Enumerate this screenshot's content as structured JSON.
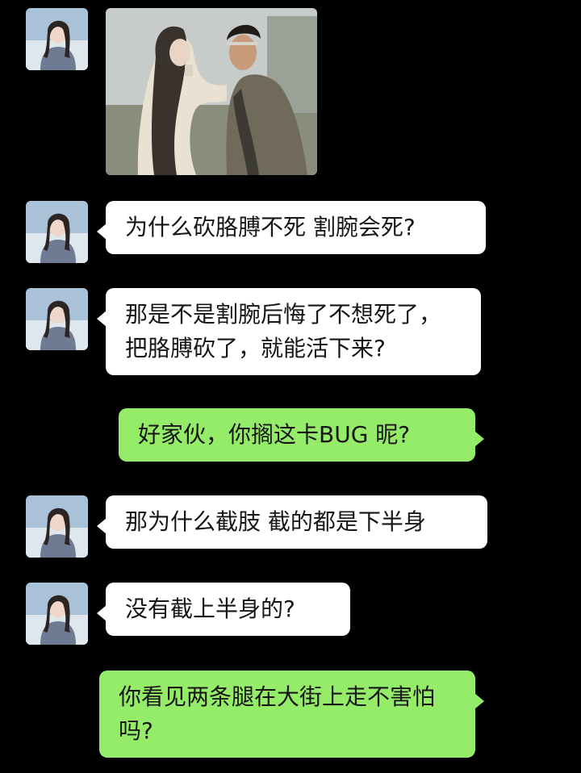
{
  "chat": {
    "messages": [
      {
        "sender": "contact",
        "kind": "image",
        "image_icon": "couple-scene-photo"
      },
      {
        "sender": "contact",
        "kind": "text",
        "text": "为什么砍胳膊不死 割腕会死?"
      },
      {
        "sender": "contact",
        "kind": "text",
        "text": "那是不是割腕后悔了不想死了，把胳膊砍了，就能活下来?"
      },
      {
        "sender": "me",
        "kind": "text",
        "text": "好家伙，你搁这卡BUG 昵?"
      },
      {
        "sender": "contact",
        "kind": "text",
        "text": "那为什么截肢 截的都是下半身"
      },
      {
        "sender": "contact",
        "kind": "text",
        "text": "没有截上半身的?"
      },
      {
        "sender": "me",
        "kind": "text",
        "text": "你看见两条腿在大街上走不害怕吗?"
      }
    ]
  },
  "colors": {
    "background": "#000000",
    "incoming_bubble": "#ffffff",
    "outgoing_bubble": "#95ec69",
    "text": "#161616"
  }
}
